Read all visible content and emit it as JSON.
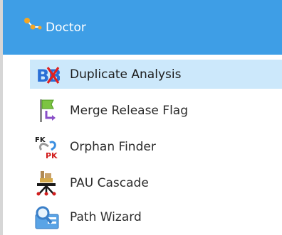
{
  "header": {
    "title": "Doctor",
    "icon": "doctor-tree-icon",
    "bg_color": "#3e9ee6"
  },
  "menu": {
    "selected_index": 0,
    "items": [
      {
        "label": "Duplicate Analysis",
        "icon": "duplicate-analysis-icon",
        "icon_text": "B"
      },
      {
        "label": "Merge Release Flag",
        "icon": "merge-release-flag-icon"
      },
      {
        "label": "Orphan Finder",
        "icon": "orphan-finder-icon",
        "icon_text_top": "FK",
        "icon_text_bottom": "PK"
      },
      {
        "label": "PAU Cascade",
        "icon": "pau-cascade-icon"
      },
      {
        "label": "Path Wizard",
        "icon": "path-wizard-icon"
      }
    ]
  }
}
